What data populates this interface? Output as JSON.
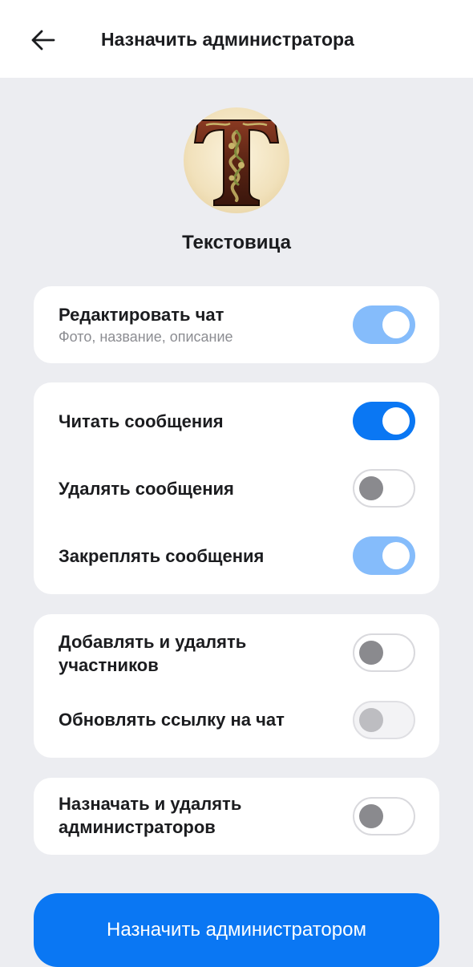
{
  "header": {
    "title": "Назначить администратора",
    "back_icon": "arrow-left-icon"
  },
  "chat": {
    "name": "Текстовица",
    "avatar_icon": "ornate-letter-t-avatar"
  },
  "groups": [
    {
      "items": [
        {
          "label": "Редактировать чат",
          "subtitle": "Фото, название, описание",
          "state": "on",
          "disabled": true
        }
      ]
    },
    {
      "items": [
        {
          "label": "Читать сообщения",
          "state": "on",
          "disabled": false
        },
        {
          "label": "Удалять сообщения",
          "state": "off",
          "disabled": false
        },
        {
          "label": "Закреплять сообщения",
          "state": "on",
          "disabled": true
        }
      ]
    },
    {
      "items": [
        {
          "label": "Добавлять и удалять участников",
          "label_lines": [
            "Добавлять и удалять",
            "участников"
          ],
          "state": "off",
          "disabled": false
        },
        {
          "label": "Обновлять ссылку на чат",
          "state": "off",
          "disabled": true
        }
      ]
    },
    {
      "items": [
        {
          "label": "Назначать и удалять администраторов",
          "label_lines": [
            "Назначать и удалять",
            "администраторов"
          ],
          "state": "off",
          "disabled": false
        }
      ]
    }
  ],
  "primary_button": {
    "label": "Назначить администратором"
  },
  "colors": {
    "accent": "#0a77f3",
    "accent_faded": "#85bcfb",
    "background": "#ecedf1",
    "card": "#ffffff"
  }
}
